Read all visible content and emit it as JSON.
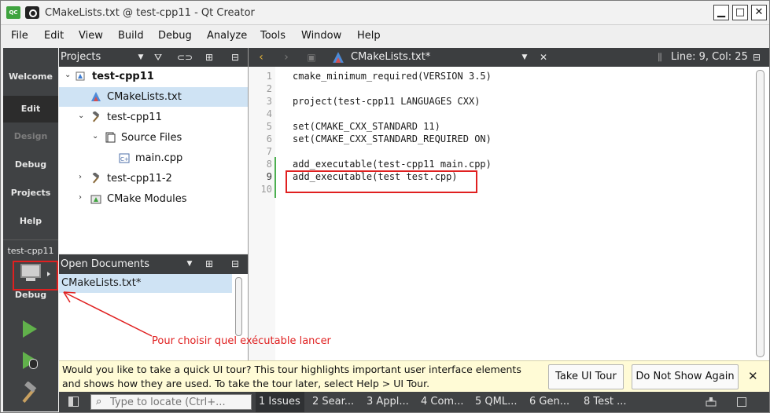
{
  "window": {
    "title": "CMakeLists.txt @ test-cpp11 - Qt Creator",
    "app_icon_text": "QC"
  },
  "window_controls": {
    "minimize": "▁",
    "maximize": "□",
    "close": "✕"
  },
  "menu": [
    "File",
    "Edit",
    "View",
    "Build",
    "Debug",
    "Analyze",
    "Tools",
    "Window",
    "Help"
  ],
  "modes": {
    "welcome": "Welcome",
    "edit": "Edit",
    "design": "Design",
    "debug": "Debug",
    "projects": "Projects",
    "help": "Help"
  },
  "kit": {
    "project": "test-cpp11",
    "build_mode": "Debug"
  },
  "projects_pane": {
    "title": "Projects",
    "tree": [
      {
        "label": "test-cpp11",
        "level": 0,
        "bold": true,
        "expanded": true,
        "icon": "cmake-project-icon"
      },
      {
        "label": "CMakeLists.txt",
        "level": 1,
        "selected": true,
        "icon": "cmake-file-icon"
      },
      {
        "label": "test-cpp11",
        "level": 1,
        "expanded": true,
        "icon": "target-hammer-icon"
      },
      {
        "label": "Source Files",
        "level": 2,
        "expanded": true,
        "icon": "folder-icon"
      },
      {
        "label": "main.cpp",
        "level": 3,
        "icon": "cpp-file-icon"
      },
      {
        "label": "test-cpp11-2",
        "level": 1,
        "expanded": false,
        "icon": "target-hammer-icon"
      },
      {
        "label": "CMake Modules",
        "level": 1,
        "expanded": false,
        "icon": "cmake-modules-icon"
      }
    ]
  },
  "open_documents": {
    "title": "Open Documents",
    "items": [
      "CMakeLists.txt*"
    ]
  },
  "editor": {
    "tab_title": "CMakeLists.txt*",
    "cursor_position": "Line: 9, Col: 25",
    "current_line": 9,
    "lines": [
      {
        "n": "1",
        "text": "cmake_minimum_required(VERSION 3.5)"
      },
      {
        "n": "2",
        "text": ""
      },
      {
        "n": "3",
        "text": "project(test-cpp11 LANGUAGES CXX)"
      },
      {
        "n": "4",
        "text": ""
      },
      {
        "n": "5",
        "text": "set(CMAKE_CXX_STANDARD 11)"
      },
      {
        "n": "6",
        "text": "set(CMAKE_CXX_STANDARD_REQUIRED ON)"
      },
      {
        "n": "7",
        "text": ""
      },
      {
        "n": "8",
        "text": "add_executable(test-cpp11 main.cpp)"
      },
      {
        "n": "9",
        "text": "add_executable(test test.cpp)"
      },
      {
        "n": "10",
        "text": ""
      }
    ]
  },
  "annotation": {
    "text": "Pour choisir quel exécutable lancer",
    "color": "#e02020"
  },
  "info_bar": {
    "message": "Would you like to take a quick UI tour? This tour highlights important user interface elements and shows how they are used. To take the tour later, select Help > UI Tour.",
    "take_tour": "Take UI Tour",
    "dont_show": "Do Not Show Again",
    "close": "✕"
  },
  "status_bar": {
    "locator_placeholder": "Type to locate (Ctrl+...",
    "tabs": [
      "1 Issues",
      "2 Sear...",
      "3 Appl...",
      "4 Com...",
      "5 QML...",
      "6 Gen...",
      "8 Test ..."
    ]
  },
  "colors": {
    "accent_green": "#61b14b",
    "sidebar_bg": "#404244",
    "selection": "#cfe3f4",
    "annotation_red": "#e02020"
  }
}
